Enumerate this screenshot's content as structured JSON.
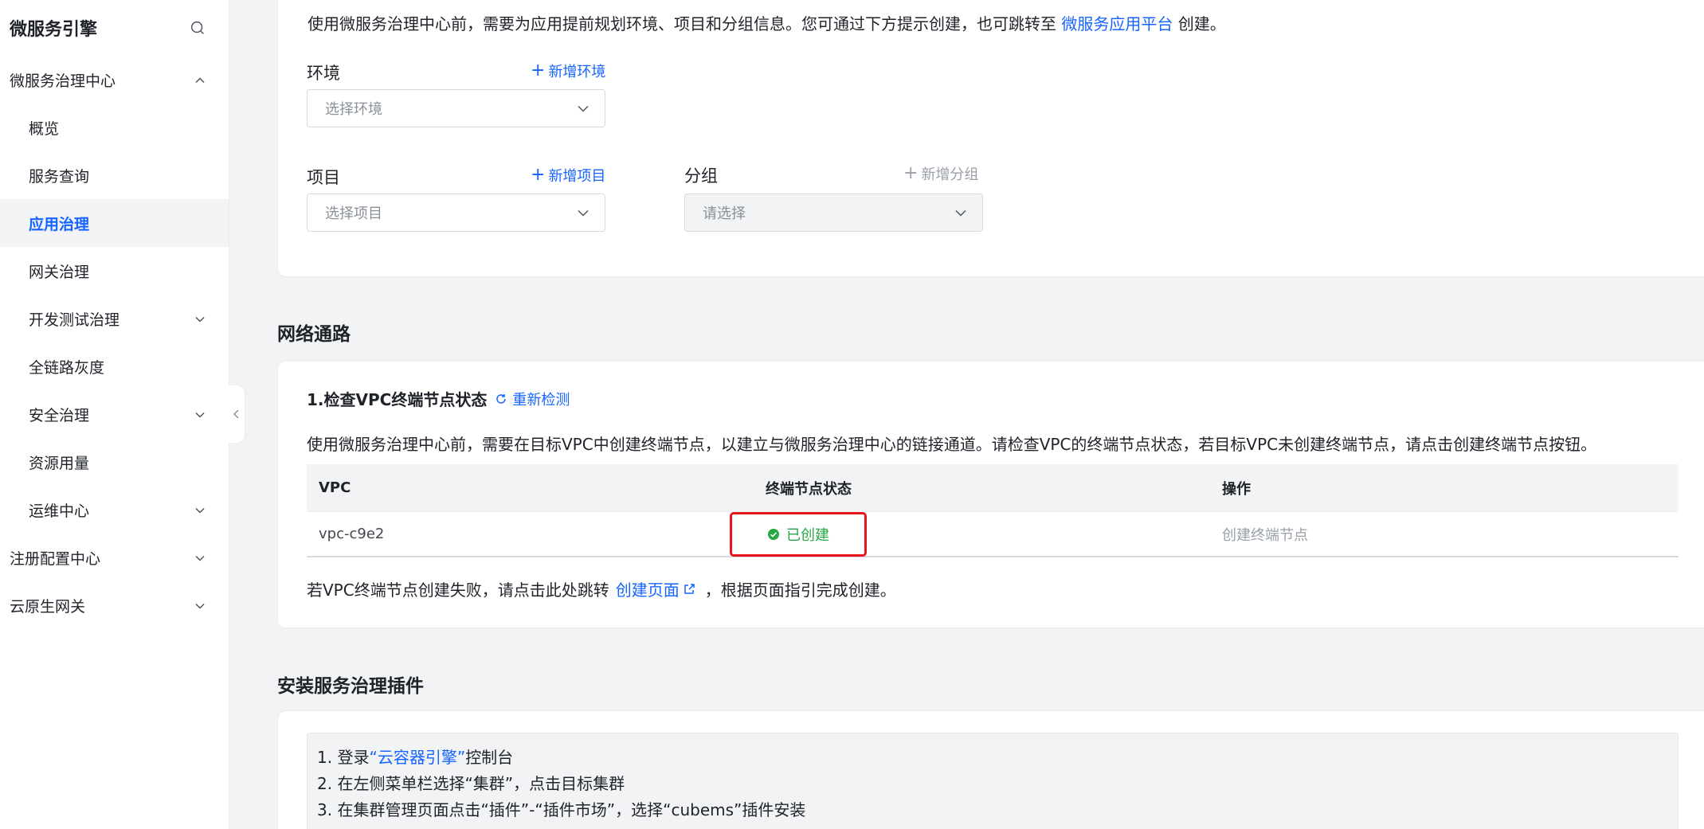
{
  "sidebar": {
    "title": "微服务引擎",
    "items": [
      {
        "label": "微服务治理中心",
        "level": 1,
        "chevron": "up"
      },
      {
        "label": "概览",
        "level": 2
      },
      {
        "label": "服务查询",
        "level": 2
      },
      {
        "label": "应用治理",
        "level": 2,
        "active": true
      },
      {
        "label": "网关治理",
        "level": 2
      },
      {
        "label": "开发测试治理",
        "level": 2,
        "chevron": "down"
      },
      {
        "label": "全链路灰度",
        "level": 2
      },
      {
        "label": "安全治理",
        "level": 2,
        "chevron": "down"
      },
      {
        "label": "资源用量",
        "level": 2
      },
      {
        "label": "运维中心",
        "level": 2,
        "chevron": "down"
      },
      {
        "label": "注册配置中心",
        "level": 1,
        "chevron": "down"
      },
      {
        "label": "云原生网关",
        "level": 1,
        "chevron": "down"
      }
    ]
  },
  "prep": {
    "intro_prefix": "使用微服务治理中心前，需要为应用提前规划环境、项目和分组信息。您可通过下方提示创建，也可跳转至",
    "intro_link": "微服务应用平台",
    "intro_suffix": "创建。",
    "env_label": "环境",
    "env_add": "新增环境",
    "env_placeholder": "选择环境",
    "project_label": "项目",
    "project_add": "新增项目",
    "project_placeholder": "选择项目",
    "group_label": "分组",
    "group_add": "新增分组",
    "group_placeholder": "请选择"
  },
  "network": {
    "section_title": "网络通路",
    "step_title": "1.检查VPC终端节点状态",
    "recheck": "重新检测",
    "desc": "使用微服务治理中心前，需要在目标VPC中创建终端节点，以建立与微服务治理中心的链接通道。请检查VPC的终端节点状态，若目标VPC未创建终端节点，请点击创建终端节点按钮。",
    "columns": [
      "VPC",
      "终端节点状态",
      "操作"
    ],
    "rows": [
      {
        "vpc": "vpc-c9e2",
        "status": "已创建",
        "action": "创建终端节点"
      }
    ],
    "fail_prefix": "若VPC终端节点创建失败，请点击此处跳转",
    "fail_link": "创建页面",
    "fail_suffix": "，根据页面指引完成创建。"
  },
  "plugin": {
    "section_title": "安装服务治理插件",
    "step1_prefix": "1. 登录",
    "step1_link": "“云容器引擎”",
    "step1_suffix": "控制台",
    "step2": "2. 在左侧菜单栏选择“集群”，点击目标集群",
    "step3": "3. 在集群管理页面点击“插件”-“插件市场”，选择“cubems”插件安装"
  },
  "colors": {
    "primary": "#1664ff",
    "success": "#28a745",
    "highlight": "#e8141c",
    "disabled": "#9aa0a8"
  }
}
